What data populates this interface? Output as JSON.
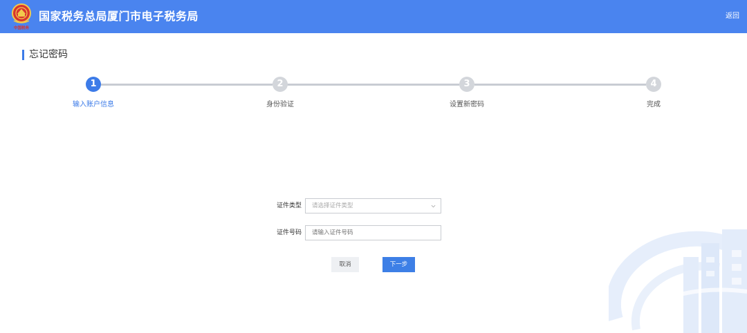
{
  "header": {
    "title": "国家税务总局厦门市电子税务局",
    "back_label": "返回",
    "emblem_caption": "中国税务"
  },
  "page": {
    "title": "忘记密码"
  },
  "steps": [
    {
      "number": "1",
      "label": "输入账户信息",
      "active": true
    },
    {
      "number": "2",
      "label": "身份验证",
      "active": false
    },
    {
      "number": "3",
      "label": "设置新密码",
      "active": false
    },
    {
      "number": "4",
      "label": "完成",
      "active": false
    }
  ],
  "form": {
    "id_type_label": "证件类型",
    "id_type_placeholder": "请选择证件类型",
    "id_number_label": "证件号码",
    "id_number_placeholder": "请输入证件号码"
  },
  "actions": {
    "cancel_label": "取消",
    "next_label": "下一步"
  },
  "icons": {
    "emblem": "tax-emblem-icon",
    "dropdown": "chevron-down-icon",
    "watermark": "building-watermark-icon"
  },
  "colors": {
    "header": "#4a84ef",
    "accent": "#3c7be8",
    "inactive": "#d3d6db"
  }
}
